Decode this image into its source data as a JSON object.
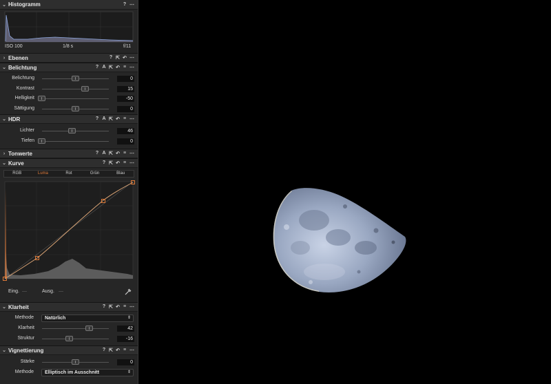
{
  "panel": {
    "histogram": {
      "title": "Histogramm",
      "iso": "ISO 100",
      "shutter": "1/8 s",
      "aperture": "f/11"
    },
    "ebenen": {
      "title": "Ebenen"
    },
    "belichtung": {
      "title": "Belichtung",
      "sliders": [
        {
          "label": "Belichtung",
          "value": "0"
        },
        {
          "label": "Kontrast",
          "value": "15"
        },
        {
          "label": "Helligkeit",
          "value": "-50"
        },
        {
          "label": "Sättigung",
          "value": "0"
        }
      ]
    },
    "hdr": {
      "title": "HDR",
      "sliders": [
        {
          "label": "Lichter",
          "value": "46"
        },
        {
          "label": "Tiefen",
          "value": "0"
        }
      ]
    },
    "tonwerte": {
      "title": "Tonwerte"
    },
    "kurve": {
      "title": "Kurve",
      "tabs": [
        "RGB",
        "Luma",
        "Rot",
        "Grün",
        "Blau"
      ],
      "active_tab": "Luma",
      "input_label": "Eing.",
      "output_label": "Ausg."
    },
    "klarheit": {
      "title": "Klarheit",
      "method_label": "Methode",
      "method_value": "Natürlich",
      "sliders": [
        {
          "label": "Klarheit",
          "value": "42"
        },
        {
          "label": "Struktur",
          "value": "-16"
        }
      ]
    },
    "vignettierung": {
      "title": "Vignettierung",
      "sliders": [
        {
          "label": "Stärke",
          "value": "0"
        }
      ],
      "method_label": "Methode",
      "method_value": "Elliptisch im Ausschnitt"
    }
  },
  "icons": {
    "help": "?",
    "auto": "A",
    "copy": "⇱",
    "reset": "↶",
    "menu": "≡",
    "more": "⋯",
    "expanded": "⌄",
    "collapsed": "›"
  },
  "colors": {
    "accent": "#e07b39",
    "panel_bg": "#262626",
    "viewer_bg": "#000000"
  }
}
